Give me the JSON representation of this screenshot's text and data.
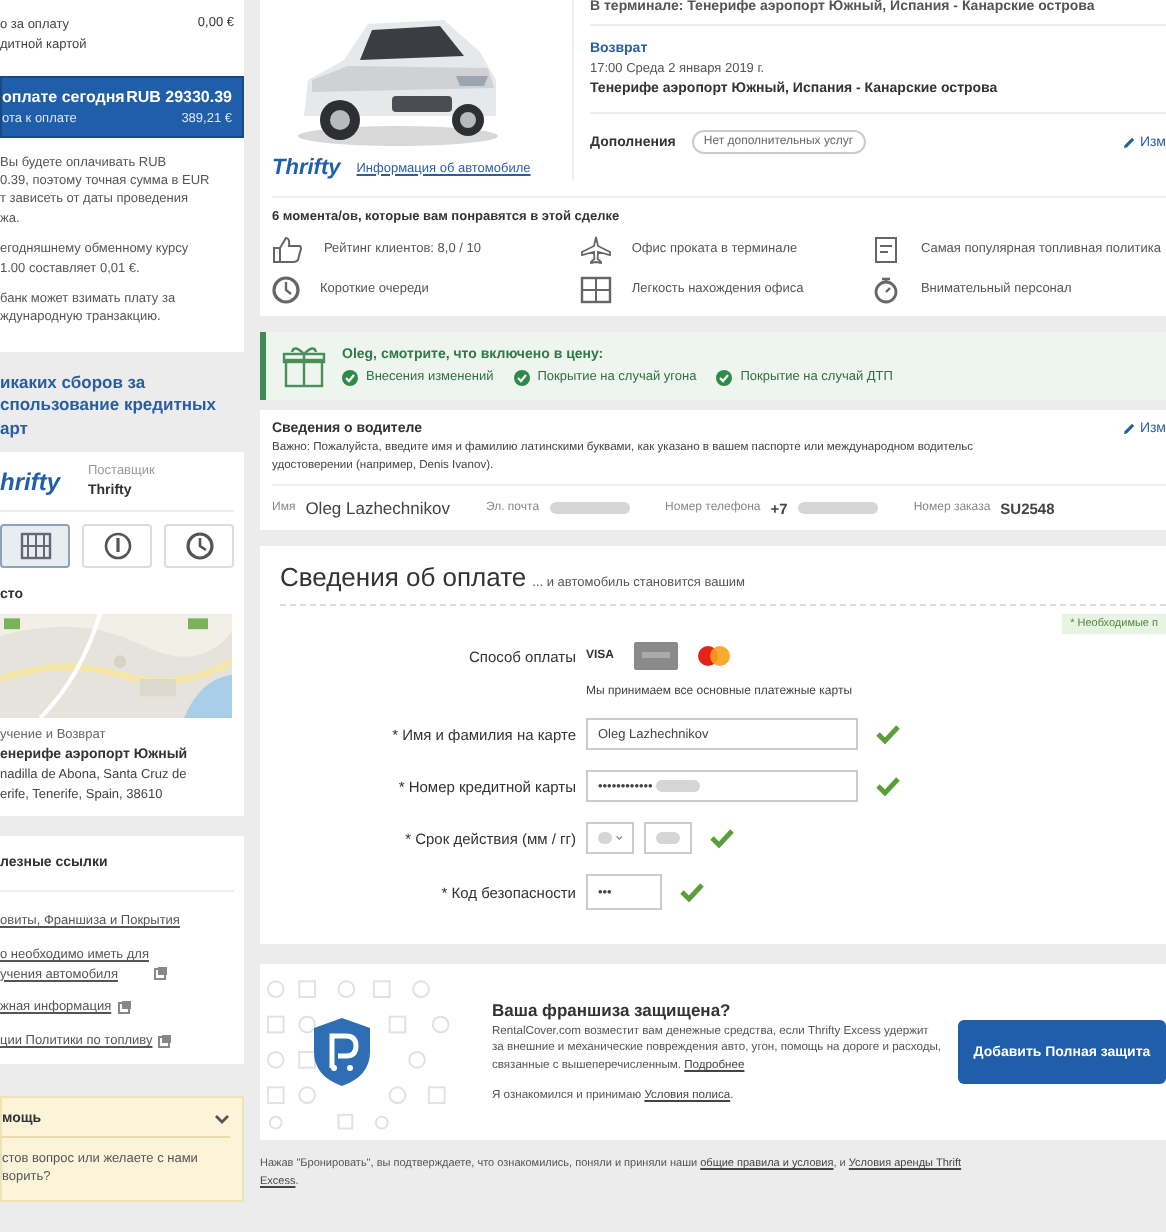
{
  "sidebar": {
    "card_payment": {
      "lines": [
        "о за оплату",
        "дитной картой"
      ],
      "amount": "0,00 €"
    },
    "due_today": {
      "title": "оплате сегодня",
      "amount": "RUB 29330.39",
      "subtitle": "ота к оплате",
      "amount_eur": "389,21 €"
    },
    "notes": [
      [
        "Вы будете оплачивать RUB",
        "0.39, поэтому точная сумма в EUR",
        "т зависеть от даты проведения",
        "жа."
      ],
      [
        "егодняшнему обменному курсу",
        "1.00 составляет 0,01 €."
      ],
      [
        "банк может взимать плату за",
        "ждународную транзакцию."
      ]
    ],
    "no_fees": [
      "икаких сборов за",
      "спользование кредитных",
      "арт"
    ],
    "supplier": {
      "logo": "hrifty",
      "label": "Поставщик",
      "name": "Thrifty"
    },
    "view_tabs": [
      {
        "kind": "map",
        "selected": true
      },
      {
        "kind": "info",
        "selected": false
      },
      {
        "kind": "clock",
        "selected": false
      }
    ],
    "location": {
      "heading": "сто",
      "pickup_label": "учение и Возврат",
      "pickup_name": "енерифе аэропорт Южный",
      "address": [
        "nadilla de Abona, Santa Cruz de",
        "erife, Tenerife, Spain, 38610"
      ]
    },
    "links": {
      "heading": "лезные ссылки",
      "items": [
        {
          "lines": [
            "овиты, Франшиза и Покрытия"
          ],
          "external": false
        },
        {
          "lines": [
            "о необходимо иметь для",
            "учения автомобиля"
          ],
          "external": true
        },
        {
          "lines": [
            "жная информация"
          ],
          "external": true
        },
        {
          "lines": [
            "ции Политики по топливу"
          ],
          "external": true
        }
      ]
    },
    "help": {
      "title": "мощь",
      "expanded": true,
      "lines": [
        "стов вопрос или желаете с нами",
        "ворить?"
      ]
    }
  },
  "trip": {
    "pickup_line": "В терминале: Тенерифе аэропорт Южный, Испания - Канарские острова",
    "return": {
      "label": "Возврат",
      "time": "17:00 Среда 2 января 2019 г.",
      "place": "Тенерифе аэропорт Южный, Испания - Канарские острова"
    },
    "extras": {
      "label": "Дополнения",
      "value": "Нет дополнительных услуг",
      "edit": "Изм"
    },
    "vehicle": {
      "logo": "Thrifty",
      "info_link": "Информация об автомобиле"
    }
  },
  "highlights": {
    "title": "6 момента/ов, которые вам понравятся в этой сделке",
    "items": [
      {
        "kind": "thumb",
        "text": "Рейтинг клиентов: 8,0 / 10"
      },
      {
        "kind": "plane",
        "text": "Офис проката в терминале"
      },
      {
        "kind": "fuel",
        "text": "Самая популярная топливная политика"
      },
      {
        "kind": "clock",
        "text": "Короткие очереди"
      },
      {
        "kind": "map",
        "text": "Легкость нахождения офиса"
      },
      {
        "kind": "stopwatch",
        "text": "Внимательный персонал"
      }
    ]
  },
  "included": {
    "title": "Oleg, смотрите, что включено в цену:",
    "items": [
      "Внесения изменений",
      "Покрытие на случай угона",
      "Покрытие на случай ДТП"
    ]
  },
  "driver": {
    "title": "Сведения о водителе",
    "edit": "Изм",
    "note_lines": [
      "Важно: Пожалуйста, введите имя и фамилию латинскими буквами, как указано в вашем паспорте или международном водительс",
      "удостоверении (например, Denis Ivanov)."
    ],
    "fields": [
      {
        "label": "Имя",
        "kind": "text",
        "value": "Oleg Lazhechnikov"
      },
      {
        "label": "Эл. почта",
        "kind": "hidden"
      },
      {
        "label": "Номер телефона",
        "kind": "partial",
        "value": "+7"
      },
      {
        "label": "Номер заказа",
        "kind": "text",
        "value": "SU2548"
      }
    ]
  },
  "payment": {
    "title": "Сведения об оплате",
    "subtitle": "... и автомобиль становится вашим",
    "required_note": "* Необходимые п",
    "method_label": "Способ оплаты",
    "cards": [
      {
        "kind": "visa",
        "label": "VISA"
      },
      {
        "kind": "generic"
      },
      {
        "kind": "mastercard"
      }
    ],
    "cards_note": "Мы принимаем все основные платежные карты",
    "fields": [
      {
        "label": "* Имя и фамилия на карте",
        "kind": "text",
        "value": "Oleg Lazhechnikov",
        "valid": true
      },
      {
        "label": "* Номер кредитной карты",
        "kind": "masked",
        "value": "••••••••••••",
        "valid": true
      },
      {
        "label": "* Срок действия (мм / гг)",
        "kind": "expiry",
        "valid": true
      },
      {
        "label": "* Код безопасности",
        "kind": "cvv",
        "value": "•••",
        "valid": true
      }
    ]
  },
  "cover": {
    "title": "Ваша франшиза защищена?",
    "text": "RentalCover.com возместит вам денежные средства, если Thrifty Excess удержит за внешние и механические повреждения авто, угон, помощь на дороге и расходы, связанные с вышеперечисленным.",
    "more_link": "Подробнее",
    "accept_before": "Я ознакомился и принимаю ",
    "accept_link": "Условия полиса",
    "accept_after": ".",
    "button": "Добавить Полная защита"
  },
  "footer": {
    "before": "Нажав \"Бронировать\", вы подтверждаете, что ознакомились, поняли и приняли наши ",
    "link1": "общие правила и условия",
    "middle": ", и ",
    "link2": "Условия аренды Thrift",
    "link3": "Excess",
    "after": "."
  }
}
